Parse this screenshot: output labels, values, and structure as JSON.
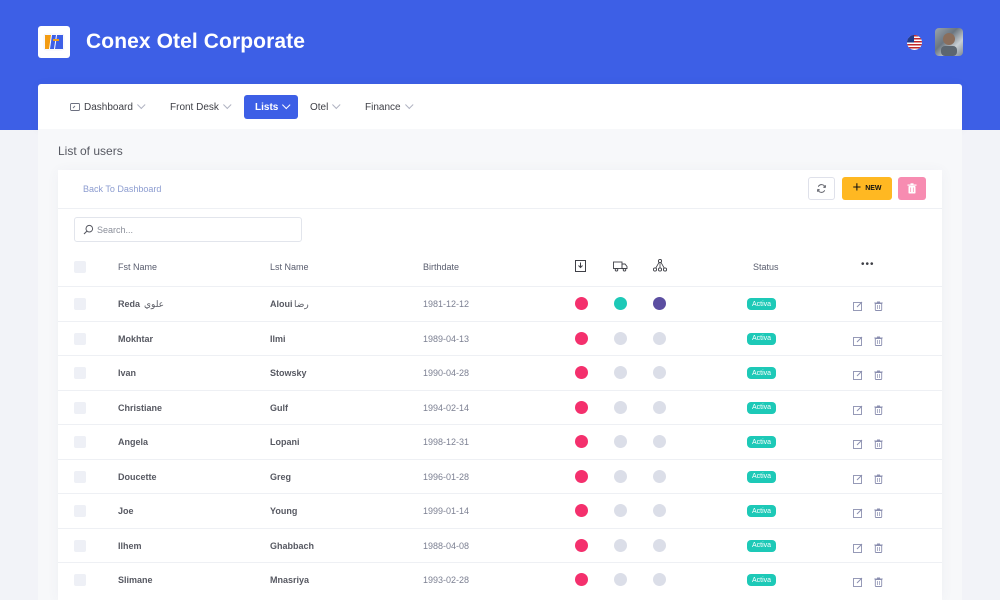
{
  "app": {
    "title": "Conex Otel Corporate"
  },
  "colors": {
    "primary": "#3d5fe6",
    "warning": "#ffb822",
    "danger": "#f78cb1",
    "success": "#1dc9b7",
    "dot_red": "#f4306d",
    "dot_teal": "#1dc9b7",
    "dot_purple": "#5b4ea1",
    "dot_grey": "#dbdee8"
  },
  "nav": {
    "items": [
      {
        "label": "Dashboard",
        "icon": "dashboard-icon",
        "active": false
      },
      {
        "label": "Front Desk",
        "active": false
      },
      {
        "label": "Lists",
        "active": true
      },
      {
        "label": "Otel",
        "active": false
      },
      {
        "label": "Finance",
        "active": false
      }
    ]
  },
  "page": {
    "title": "List of users",
    "back_label": "Back To Dashboard"
  },
  "toolbar": {
    "new_label": "NEW"
  },
  "search": {
    "placeholder": "Search..."
  },
  "table": {
    "columns": {
      "first_name": "Fst Name",
      "last_name": "Lst Name",
      "birthdate": "Birthdate",
      "status": "Status",
      "more": "•••"
    },
    "column_icons": [
      "door-icon",
      "truck-icon",
      "network-icon"
    ],
    "rows": [
      {
        "first": "Reda",
        "first_extra": "علوي",
        "last": "Aloui",
        "last_extra": "رضا",
        "birth": "1981-12-12",
        "flags": [
          "red",
          "teal",
          "purple"
        ],
        "status": "Activa"
      },
      {
        "first": "Mokhtar",
        "last": "Ilmi",
        "birth": "1989-04-13",
        "flags": [
          "red",
          "grey",
          "grey"
        ],
        "status": "Activa"
      },
      {
        "first": "Ivan",
        "last": "Stowsky",
        "birth": "1990-04-28",
        "flags": [
          "red",
          "grey",
          "grey"
        ],
        "status": "Activa"
      },
      {
        "first": "Christiane",
        "last": "Gulf",
        "birth": "1994-02-14",
        "flags": [
          "red",
          "grey",
          "grey"
        ],
        "status": "Activa"
      },
      {
        "first": "Angela",
        "last": "Lopani",
        "birth": "1998-12-31",
        "flags": [
          "red",
          "grey",
          "grey"
        ],
        "status": "Activa"
      },
      {
        "first": "Doucette",
        "last": "Greg",
        "birth": "1996-01-28",
        "flags": [
          "red",
          "grey",
          "grey"
        ],
        "status": "Activa"
      },
      {
        "first": "Joe",
        "last": "Young",
        "birth": "1999-01-14",
        "flags": [
          "red",
          "grey",
          "grey"
        ],
        "status": "Activa"
      },
      {
        "first": "Ilhem",
        "last": "Ghabbach",
        "birth": "1988-04-08",
        "flags": [
          "red",
          "grey",
          "grey"
        ],
        "status": "Activa"
      },
      {
        "first": "Slimane",
        "last": "Mnasriya",
        "birth": "1993-02-28",
        "flags": [
          "red",
          "grey",
          "grey"
        ],
        "status": "Activa"
      }
    ]
  }
}
